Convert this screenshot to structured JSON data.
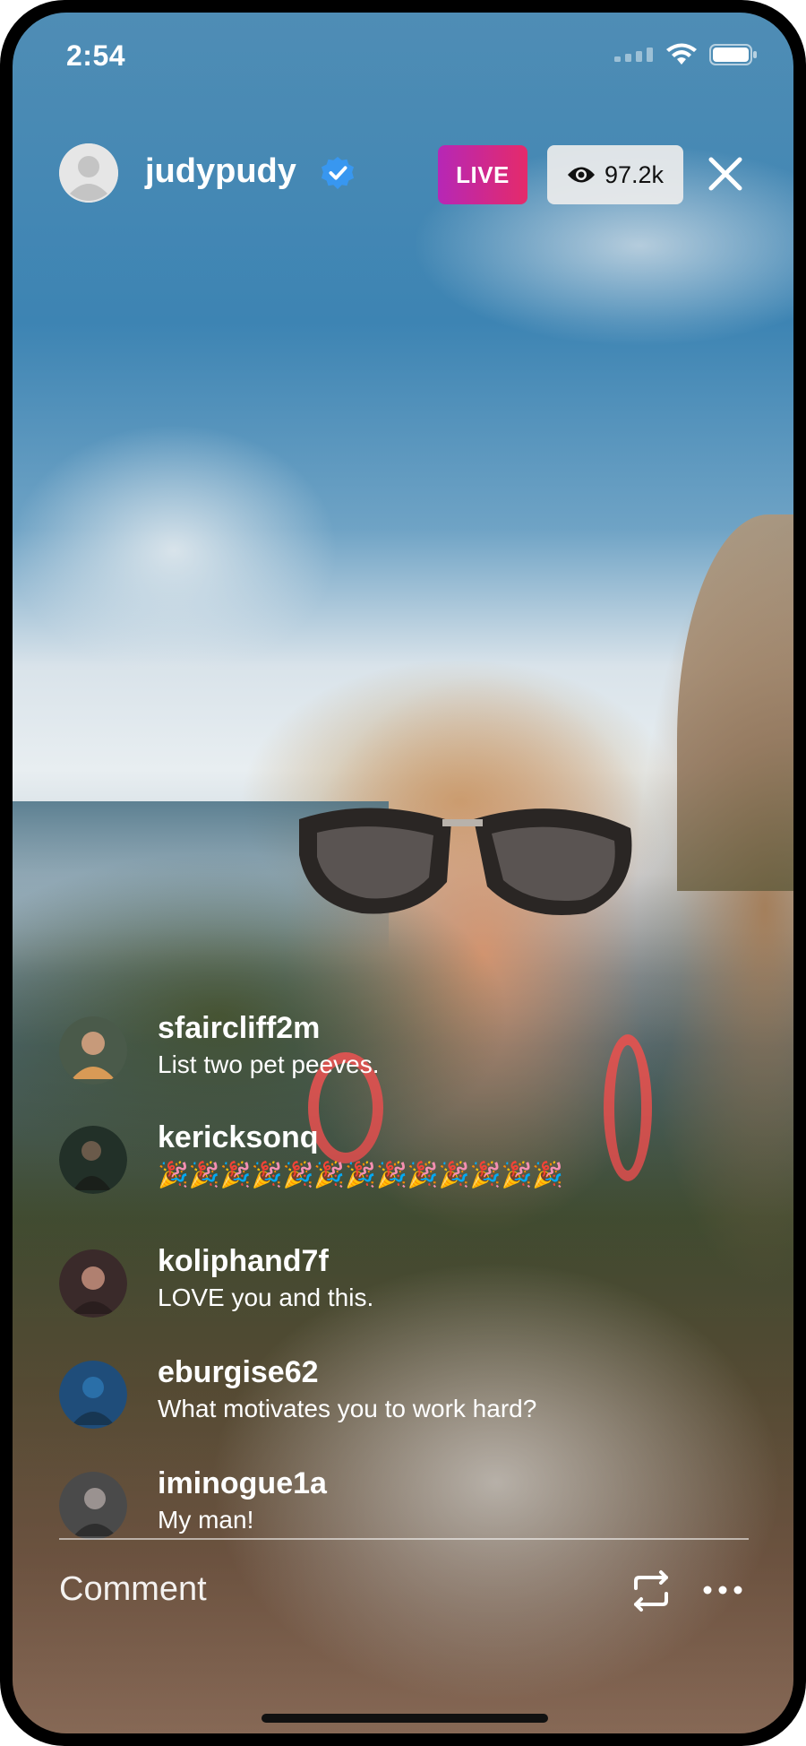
{
  "status_bar": {
    "time": "2:54"
  },
  "host": {
    "username": "judypudy",
    "verified": true
  },
  "live": {
    "badge_label": "LIVE",
    "viewer_count": "97.2k"
  },
  "comments": [
    {
      "username": "sfaircliff2m",
      "text": "List two pet peeves.",
      "avatar_color": "#4a5a4a"
    },
    {
      "username": "kericksonq",
      "text": "🎉🎉🎉🎉🎉🎉🎉🎉🎉🎉🎉🎉🎉",
      "avatar_color": "#223028"
    },
    {
      "username": "koliphand7f",
      "text": "LOVE you and this.",
      "avatar_color": "#3a2a2a"
    },
    {
      "username": "eburgise62",
      "text": "What motivates you to work hard?",
      "avatar_color": "#1f4d7a"
    },
    {
      "username": "iminogue1a",
      "text": "My man!",
      "avatar_color": "#4a4a4a"
    }
  ],
  "comment_bar": {
    "placeholder": "Comment"
  },
  "icons": {
    "wifi": "wifi-icon",
    "battery": "battery-icon",
    "signal": "signal-icon",
    "verified": "verified-badge-icon",
    "eye": "eye-icon",
    "close": "close-icon",
    "flip": "flip-camera-icon",
    "more": "more-icon"
  },
  "colors": {
    "live_gradient_start": "#b627b6",
    "live_gradient_end": "#e52a6a",
    "verified_blue": "#3897f0"
  }
}
